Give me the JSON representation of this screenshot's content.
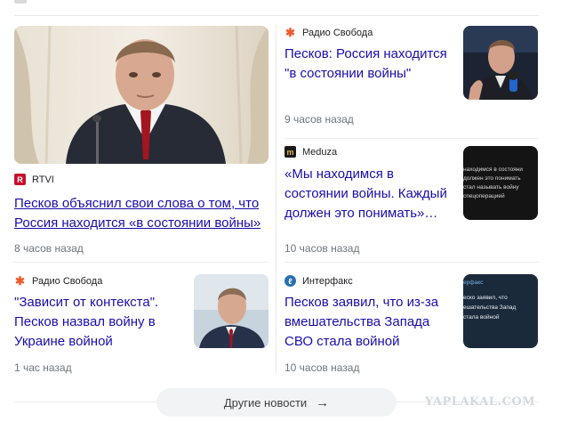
{
  "cards": {
    "big": {
      "source": "RTVI",
      "title_line1": "Песков объяснил свои слова о том, что",
      "title_line2": "Россия находится «в состоянии войны»",
      "time": "8 часов назад"
    },
    "r1": {
      "source": "Радио Свобода",
      "title_line1": "Песков: Россия находится",
      "title_line2": "\"в состоянии войны\"",
      "time": "9 часов назад"
    },
    "r2": {
      "source": "Meduza",
      "title_line1": "«Мы находимся в",
      "title_line2": "состоянии войны. Каждый",
      "title_line3": "должен это понимать»…",
      "time": "10 часов назад",
      "thumb_lines": [
        "находимся в состояни",
        "должен это понимать",
        "стал называть войну",
        "спецоперацией"
      ]
    },
    "bl": {
      "source": "Радио Свобода",
      "title_line1": "\"Зависит от контекста\".",
      "title_line2": "Песков назвал войну в",
      "title_line3": "Украине войной",
      "time": "1 час назад"
    },
    "br": {
      "source": "Интерфакс",
      "title_line1": "Песков заявил, что из-за",
      "title_line2": "вмешательства Запада",
      "title_line3": "СВО стала войной",
      "time": "10 часов назад",
      "thumb_lines": [
        "ерфакс",
        "еско заявил, что",
        "ешательства Запад",
        "стала войной"
      ]
    }
  },
  "more_button": {
    "label": "Другие новости",
    "arrow": "→"
  },
  "watermark": "YAPLAKAL.COM",
  "colors": {
    "link": "#1a0dab",
    "rtvi": "#c8102e",
    "svoboda": "#f0592a",
    "meduza": "#1a1a1a",
    "interfax": "#2a6fb0"
  }
}
